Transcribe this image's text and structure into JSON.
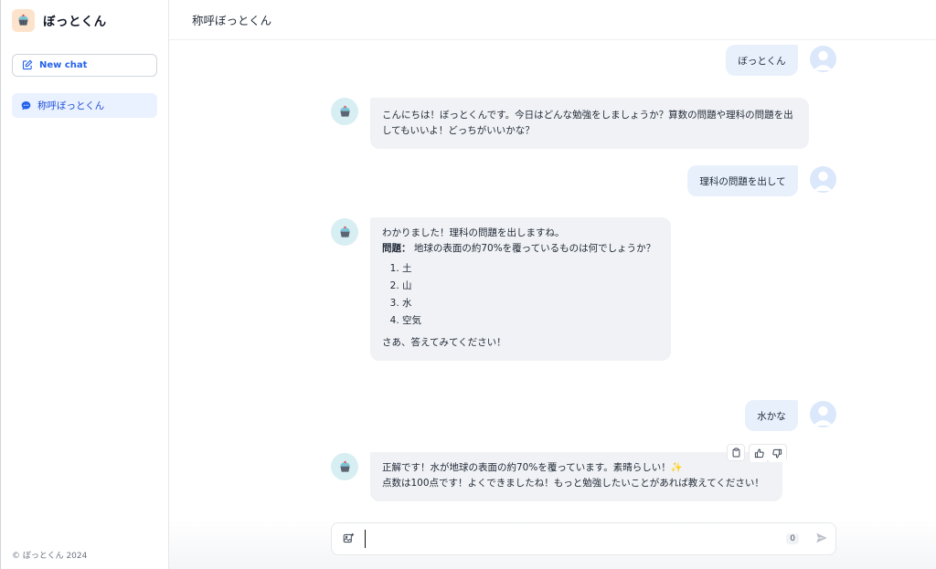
{
  "sidebar": {
    "brand_name": "ぼっとくん",
    "new_chat_label": "New chat",
    "history": [
      {
        "label": "称呼ぼっとくん"
      }
    ],
    "footer": "© ぼっとくん 2024"
  },
  "header": {
    "title": "称呼ぼっとくん"
  },
  "messages": [
    {
      "role": "user",
      "text": "ぼっとくん"
    },
    {
      "role": "bot",
      "text": "こんにちは！ぼっとくんです。今日はどんな勉強をしましょうか？算数の問題や理科の問題を出してもいいよ！どっちがいいかな？"
    },
    {
      "role": "user",
      "text": "理科の問題を出して"
    },
    {
      "role": "bot",
      "intro": "わかりました！理科の問題を出しますね。",
      "question_label": "問題：",
      "question": "地球の表面の約70%を覆っているものは何でしょうか？",
      "options": [
        "土",
        "山",
        "水",
        "空気"
      ],
      "outro": "さあ、答えてみてください！"
    },
    {
      "role": "user",
      "text": "水かな"
    },
    {
      "role": "bot",
      "line1": "正解です！水が地球の表面の約70%を覆っています。素晴らしい！✨",
      "line2": "点数は100点です！よくできましたね！もっと勉強したいことがあれば教えてください！"
    }
  ],
  "composer": {
    "value": "",
    "char_count": "0"
  },
  "icons": {
    "brand": "cupcake-icon",
    "new_chat": "edit-icon",
    "history": "chat-bubble-icon",
    "copy": "clipboard-icon",
    "like": "thumbs-up-icon",
    "dislike": "thumbs-down-icon",
    "attach": "image-plus-icon",
    "send": "send-icon"
  },
  "colors": {
    "accent": "#2563eb",
    "user_bubble": "#e8f0fc",
    "bot_bubble": "#f1f2f5"
  }
}
